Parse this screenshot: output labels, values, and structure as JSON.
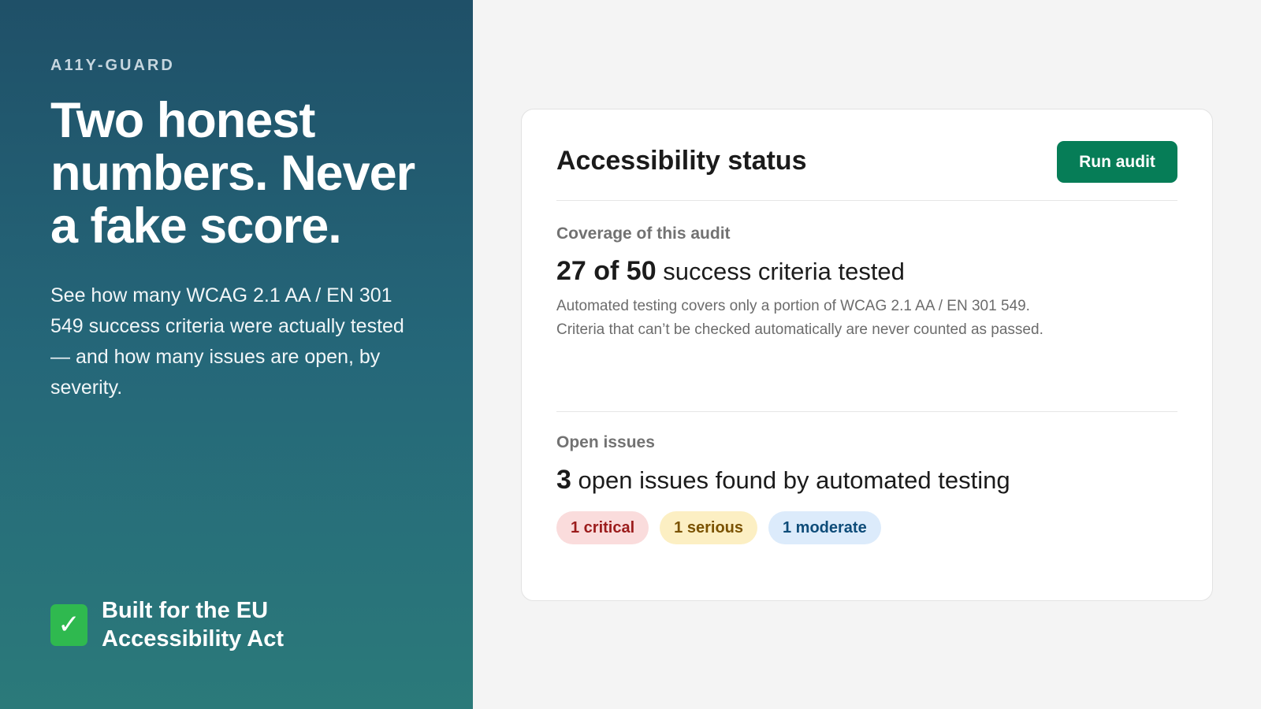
{
  "brand": "A11Y-GUARD",
  "hero": {
    "headline": "Two honest numbers. Never a fake score.",
    "description": "See how many WCAG 2.1 AA / EN 301 549 success criteria were actually tested — and how many issues are open, by severity."
  },
  "eu_badge": {
    "icon": "checkmark-icon",
    "glyph": "✓",
    "text": "Built for the EU Accessibility Act"
  },
  "card": {
    "title": "Accessibility status",
    "run_button_label": "Run audit",
    "coverage": {
      "label": "Coverage of this audit",
      "count_text": "27 of 50",
      "rest_text": " success criteria tested",
      "tested": 27,
      "total": 50,
      "note": "Automated testing covers only a portion of WCAG 2.1 AA / EN 301 549. Criteria that can’t be checked automatically are never counted as passed."
    },
    "issues": {
      "label": "Open issues",
      "count_text": "3",
      "rest_text": " open issues found by automated testing",
      "severity": [
        {
          "label": "1 critical",
          "level": "critical"
        },
        {
          "label": "1 serious",
          "level": "serious"
        },
        {
          "label": "1 moderate",
          "level": "moderate"
        }
      ]
    }
  },
  "colors": {
    "panel_gradient_top": "#1f5068",
    "panel_gradient_bottom": "#2b7a7a",
    "accent_button": "#067d57",
    "check_green": "#2fb94f",
    "critical": "#9b1c1c",
    "serious": "#7a5200",
    "moderate": "#0e4c79"
  }
}
